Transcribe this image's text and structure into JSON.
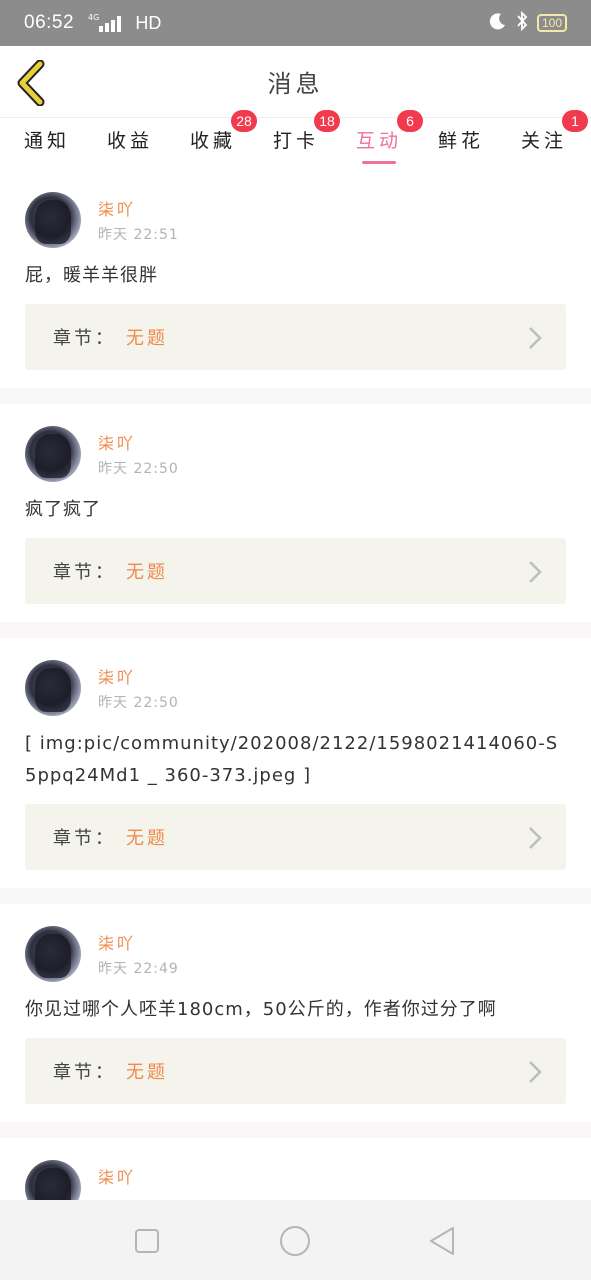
{
  "status_bar": {
    "time": "06:52",
    "network": "4G",
    "hd": "HD",
    "battery": "100",
    "icons": [
      "signal-icon",
      "moon-icon",
      "bluetooth-icon",
      "battery-icon"
    ]
  },
  "header": {
    "title": "消息",
    "back_icon": "chevron-left-icon"
  },
  "colors": {
    "accent": "#ef6fa1",
    "badge": "#f23a4e",
    "username": "#f08a4b",
    "chapter_bg": "#f4f4ec",
    "back_arrow": "#e8d03a"
  },
  "tabs": [
    {
      "label": "通知",
      "badge": ""
    },
    {
      "label": "收益",
      "badge": ""
    },
    {
      "label": "收藏",
      "badge": "28"
    },
    {
      "label": "打卡",
      "badge": "18"
    },
    {
      "label": "互动",
      "badge": "6",
      "active": true
    },
    {
      "label": "鲜花",
      "badge": ""
    },
    {
      "label": "关注",
      "badge": "1"
    }
  ],
  "messages": [
    {
      "username": "柒吖",
      "time": "昨天  22:51",
      "content": "屁，暖羊羊很胖",
      "chapter_label": "章节：",
      "chapter_value": "无题"
    },
    {
      "username": "柒吖",
      "time": "昨天  22:50",
      "content": "疯了疯了",
      "chapter_label": "章节：",
      "chapter_value": "无题"
    },
    {
      "username": "柒吖",
      "time": "昨天  22:50",
      "content": "[ img:pic/community/202008/2122/1598021414060-S5ppq24Md1 _ 360-373.jpeg ]",
      "chapter_label": "章节：",
      "chapter_value": "无题"
    },
    {
      "username": "柒吖",
      "time": "昨天  22:49",
      "content": "你见过哪个人呸羊180cm，50公斤的，作者你过分了啊",
      "chapter_label": "章节：",
      "chapter_value": "无题"
    },
    {
      "username": "柒吖",
      "time": "",
      "content": "",
      "chapter_label": "",
      "chapter_value": ""
    }
  ],
  "nav_bar": {
    "icons": [
      "recent-apps-icon",
      "home-icon",
      "back-icon"
    ]
  }
}
